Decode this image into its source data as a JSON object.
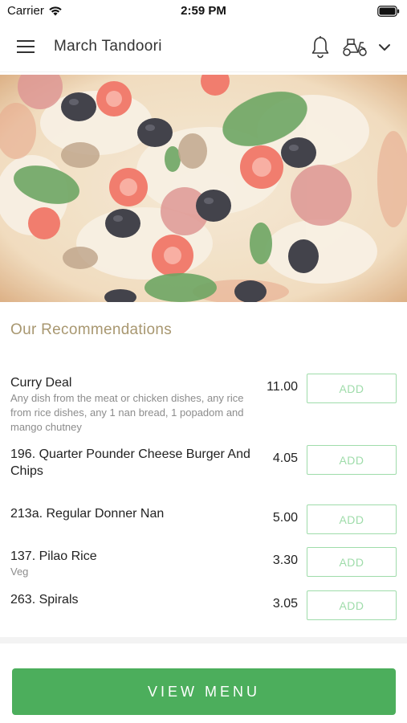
{
  "status_bar": {
    "carrier": "Carrier",
    "time": "2:59 PM"
  },
  "header": {
    "title": "March Tandoori",
    "icons": [
      "hamburger-menu-icon",
      "bell-icon",
      "scooter-icon",
      "chevron-down-icon"
    ]
  },
  "hero": {
    "image": "pizza-photo"
  },
  "recommendations": {
    "title": "Our Recommendations",
    "add_label": "ADD",
    "items": [
      {
        "name": "Curry Deal",
        "description": "Any dish from the meat or chicken dishes, any rice from rice dishes, any 1 nan bread, 1 popadom and mango chutney",
        "price": "11.00"
      },
      {
        "name": "196. Quarter Pounder Cheese Burger And Chips",
        "description": "",
        "price": "4.05"
      },
      {
        "name": "213a. Regular Donner Nan",
        "description": "",
        "price": "5.00"
      },
      {
        "name": "137. Pilao Rice",
        "description": "Veg",
        "price": "3.30"
      },
      {
        "name": "263. Spirals",
        "description": "",
        "price": "3.05"
      }
    ]
  },
  "footer": {
    "view_menu_label": "VIEW MENU"
  },
  "colors": {
    "accent_green": "#4cae5c",
    "add_border": "#9fdcaa",
    "section_title": "#a89770"
  }
}
